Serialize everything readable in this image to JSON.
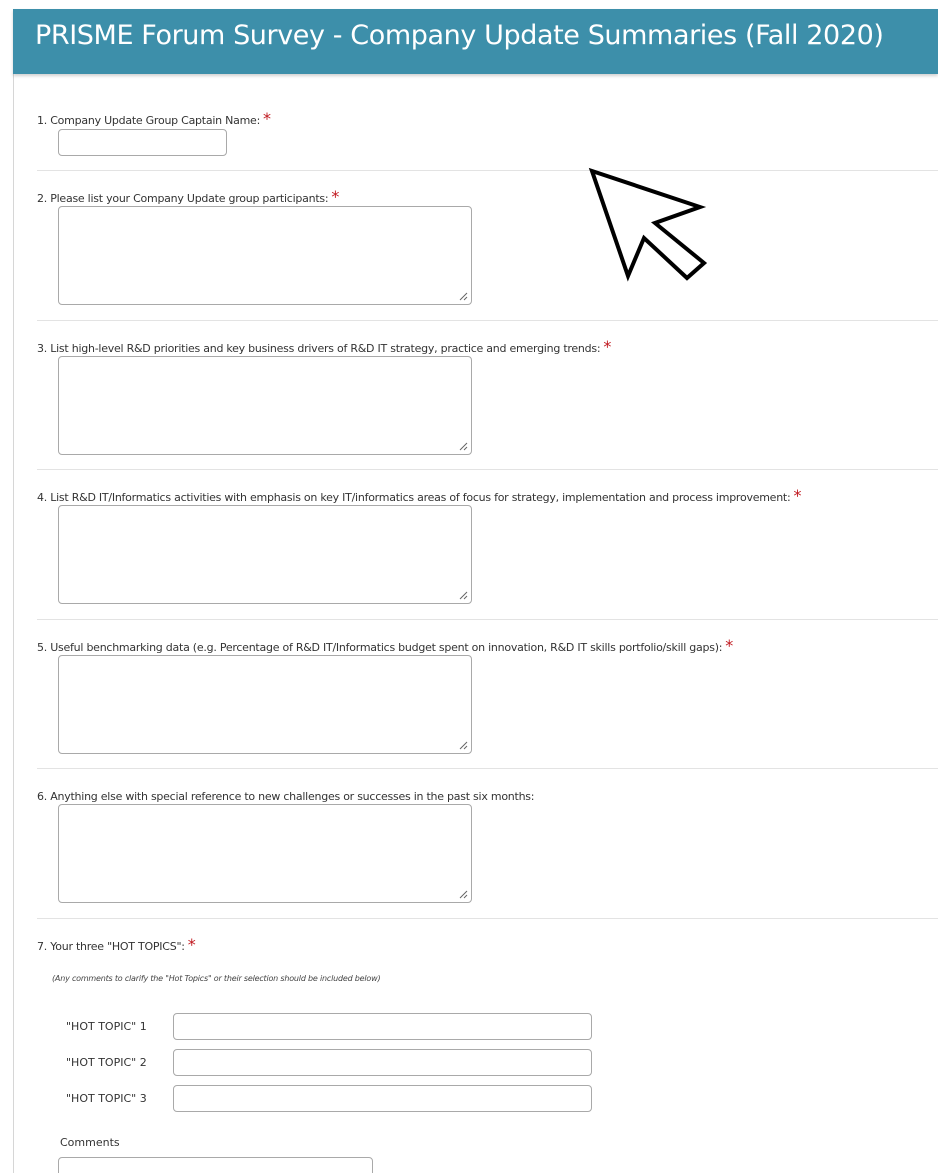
{
  "header": {
    "title": "PRISME Forum Survey - Company Update Summaries (Fall 2020)"
  },
  "questions": [
    {
      "label": "1. Company Update Group Captain Name:",
      "required_mark": "*",
      "value": ""
    },
    {
      "label": "2. Please list your Company Update group participants:",
      "required_mark": "*",
      "value": ""
    },
    {
      "label": "3. List high-level R&D priorities and key business drivers of R&D IT strategy, practice and emerging trends:",
      "required_mark": "*",
      "value": ""
    },
    {
      "label": "4. List R&D IT/Informatics activities with emphasis on key IT/informatics areas of focus for strategy, implementation and process improvement:",
      "required_mark": "*",
      "value": ""
    },
    {
      "label": "5. Useful benchmarking data (e.g. Percentage of R&D IT/Informatics budget spent on innovation, R&D IT skills portfolio/skill gaps):",
      "required_mark": "*",
      "value": ""
    },
    {
      "label": "6. Anything else with special reference to new challenges or successes in the past six months:",
      "required_mark": "",
      "value": ""
    },
    {
      "label": "7. Your three \"HOT TOPICS\":",
      "required_mark": "*"
    }
  ],
  "hot_topics": {
    "note": "(Any comments to clarify the \"Hot Topics\" or their selection should be included below)",
    "items": [
      {
        "label": "\"HOT TOPIC\" 1",
        "value": ""
      },
      {
        "label": "\"HOT TOPIC\" 2",
        "value": ""
      },
      {
        "label": "\"HOT TOPIC\" 3",
        "value": ""
      }
    ],
    "comments_label": "Comments"
  },
  "colors": {
    "header_bg": "#3d8faa",
    "required": "#c0181f"
  },
  "icons": {
    "cursor": "arrow-cursor-icon",
    "resize": "resize-grip-icon"
  }
}
